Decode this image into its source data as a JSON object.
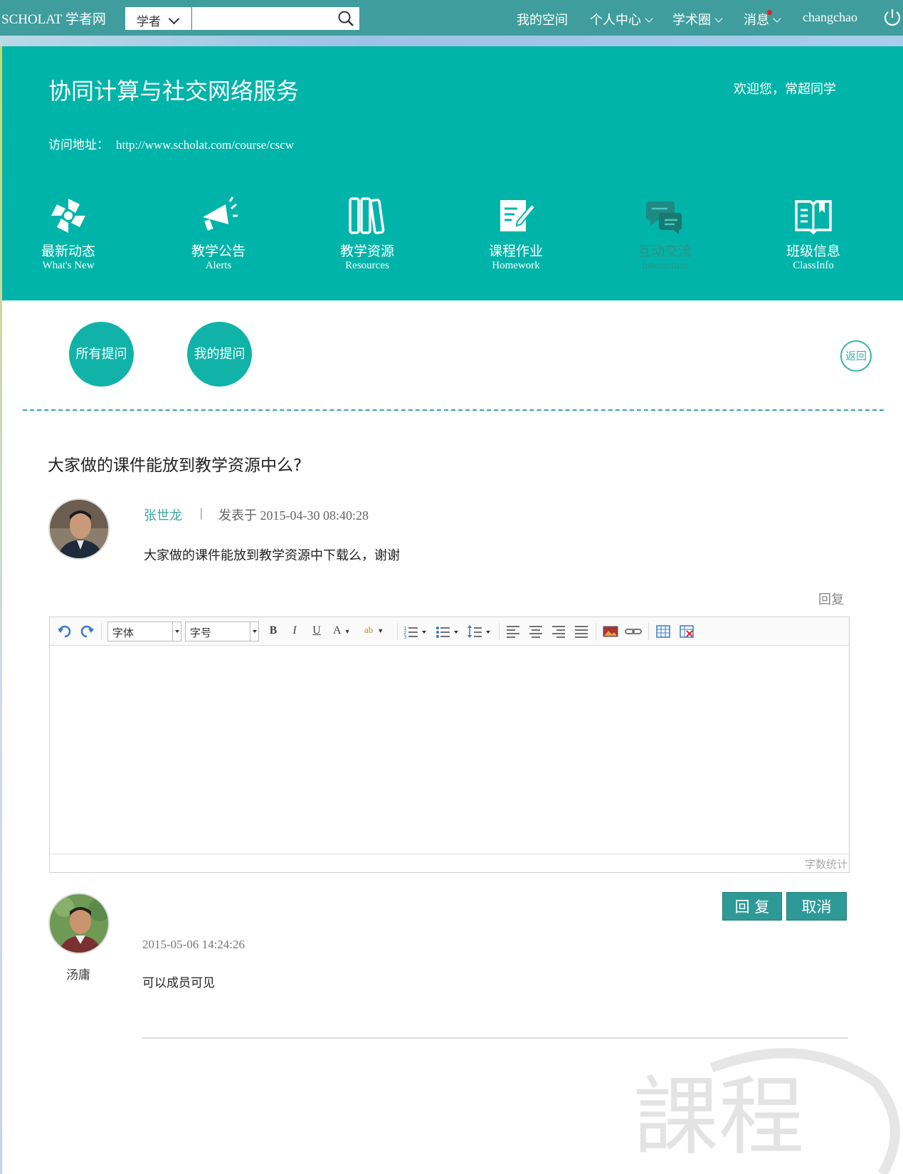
{
  "topbar": {
    "brand": "SCHOLAT 学者网",
    "search_type": "学者",
    "search_value": "",
    "nav": [
      {
        "label": "我的空间",
        "has_dropdown": false
      },
      {
        "label": "个人中心",
        "has_dropdown": true
      },
      {
        "label": "学术圈",
        "has_dropdown": true
      },
      {
        "label": "消息",
        "has_dropdown": true,
        "has_unread": true
      },
      {
        "label": "changchao",
        "has_dropdown": false
      }
    ]
  },
  "header": {
    "course_title": "协同计算与社交网络服务",
    "welcome": "欢迎您，常超同学",
    "visit_label": "访问地址：",
    "visit_url": "http://www.scholat.com/course/cscw",
    "modules": [
      {
        "cn": "最新动态",
        "en": "What's New",
        "icon": "pinwheel-icon",
        "active": true
      },
      {
        "cn": "教学公告",
        "en": "Alerts",
        "icon": "megaphone-icon",
        "active": true
      },
      {
        "cn": "教学资源",
        "en": "Resources",
        "icon": "books-icon",
        "active": true
      },
      {
        "cn": "课程作业",
        "en": "Homework",
        "icon": "edit-document-icon",
        "active": true
      },
      {
        "cn": "互动交流",
        "en": "Interaction",
        "icon": "chat-bubbles-icon",
        "active": false
      },
      {
        "cn": "班级信息",
        "en": "ClassInfo",
        "icon": "open-book-icon",
        "active": true
      }
    ]
  },
  "filters": {
    "all_questions": "所有提问",
    "my_questions": "我的提问",
    "back": "返回"
  },
  "question": {
    "title": "大家做的课件能放到教学资源中么?",
    "author": "张世龙",
    "separator": "|",
    "posted": "发表于 2015-04-30 08:40:28",
    "body": "大家做的课件能放到教学资源中下载么，谢谢",
    "reply_link": "回复"
  },
  "editor": {
    "font_family": "字体",
    "font_size": "字号",
    "word_count": "字数统计",
    "bold": "B",
    "italic": "I",
    "underline": "U",
    "font_color": "A",
    "highlight": "ab"
  },
  "actions": {
    "reply": "回 复",
    "cancel": "取消"
  },
  "reply": {
    "name": "汤庸",
    "time": "2015-05-06 14:24:26",
    "body": "可以成员可见"
  },
  "watermark": "課程",
  "colors": {
    "teal_header": "#00b4a9",
    "topbar": "#3f9e9d",
    "accent": "#3aa3a6",
    "button": "#2e9a98",
    "unread_dot": "#e02020"
  }
}
